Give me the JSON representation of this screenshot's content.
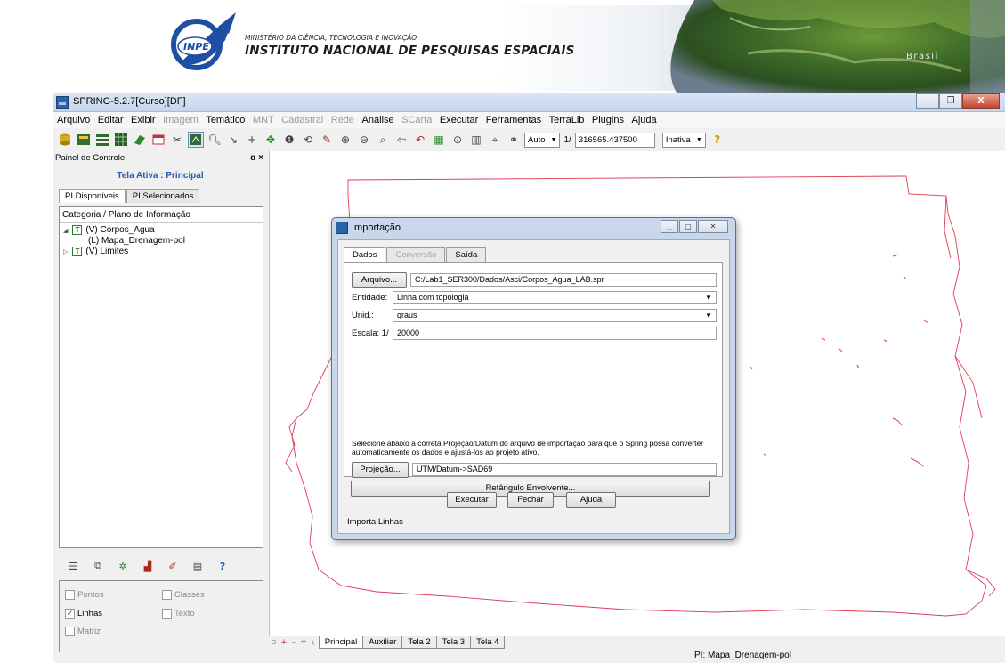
{
  "banner": {
    "logo_text": "INPE",
    "ministry": "MINISTÉRIO DA CIÊNCIA, TECNOLOGIA E INOVAÇÃO",
    "institute": "INSTITUTO NACIONAL DE PESQUISAS ESPACIAIS",
    "earth_label": "Brasil"
  },
  "window": {
    "title": "SPRING-5.2.7[Curso][DF]",
    "buttons": [
      "–",
      "❐",
      "X"
    ]
  },
  "menu": [
    {
      "label": "Arquivo",
      "enabled": true
    },
    {
      "label": "Editar",
      "enabled": true
    },
    {
      "label": "Exibir",
      "enabled": true
    },
    {
      "label": "Imagem",
      "enabled": false
    },
    {
      "label": "Temático",
      "enabled": true
    },
    {
      "label": "MNT",
      "enabled": false
    },
    {
      "label": "Cadastral",
      "enabled": false
    },
    {
      "label": "Rede",
      "enabled": false
    },
    {
      "label": "Análise",
      "enabled": true
    },
    {
      "label": "SCarta",
      "enabled": false
    },
    {
      "label": "Executar",
      "enabled": true
    },
    {
      "label": "Ferramentas",
      "enabled": true
    },
    {
      "label": "TerraLib",
      "enabled": true
    },
    {
      "label": "Plugins",
      "enabled": true
    },
    {
      "label": "Ajuda",
      "enabled": true
    }
  ],
  "toolbar": {
    "zoom_mode": "Auto",
    "scale_prefix": "1/",
    "scale_value": "316565.437500",
    "state": "Inativa",
    "help_glyph": "?"
  },
  "panel": {
    "title": "Painel de Controle",
    "header_ctrls": "ɑ ×",
    "active_screen": "Tela Ativa : Principal",
    "tabs": [
      "PI Disponíveis",
      "PI Selecionados"
    ],
    "tree_header": "Categoria / Plano de Informação",
    "tree": [
      {
        "label": "(V) Corpos_Agua",
        "badge": "T",
        "expander": "◢"
      },
      {
        "label": "(L) Mapa_Drenagem-pol",
        "badge": "",
        "expander": ""
      },
      {
        "label": "(V) Limites",
        "badge": "T",
        "expander": "▷"
      }
    ],
    "checks": [
      {
        "label": "Pontos",
        "checked": false
      },
      {
        "label": "Classes",
        "checked": false
      },
      {
        "label": "Linhas",
        "checked": true
      },
      {
        "label": "Texto",
        "checked": false
      },
      {
        "label": "Matriz",
        "checked": false
      }
    ],
    "check_mark": "✓"
  },
  "bottom_tabs": {
    "controls": [
      "▫",
      "+",
      "–",
      "=",
      "\\"
    ],
    "tabs": [
      "Principal",
      "Auxiliar",
      "Tela 2",
      "Tela 3",
      "Tela 4"
    ]
  },
  "status": "PI: Mapa_Drenagem-pol",
  "dialog": {
    "title": "Importação",
    "tabs": [
      {
        "label": "Dados",
        "enabled": true
      },
      {
        "label": "Conversão",
        "enabled": false
      },
      {
        "label": "Saída",
        "enabled": true
      }
    ],
    "arquivo_button": "Arquivo...",
    "arquivo_path": "C:/Lab1_SER300/Dados/Asci/Corpos_Agua_LAB.spr",
    "entidade_label": "Entidade:",
    "entidade_value": "Linha com topologia",
    "unid_label": "Unid.:",
    "unid_value": "graus",
    "escala_label": "Escala: 1/",
    "escala_value": "20000",
    "note": "Selecione abaixo a correta Projeção/Datum do arquivo de importação para que o Spring possa converter automaticamente os dados e ajustá-los ao projeto ativo.",
    "projecao_button": "Projeção...",
    "projecao_value": "UTM/Datum->SAD69",
    "retangulo_button": "Retângulo Envolvente...",
    "executar": "Executar",
    "fechar": "Fechar",
    "ajuda": "Ajuda",
    "status": "Importa Linhas",
    "select_arrow": "▼"
  },
  "colors": {
    "map_line": "#e03a55",
    "active_title": "#2a55b8",
    "titlebar": "#c6d6ec"
  }
}
